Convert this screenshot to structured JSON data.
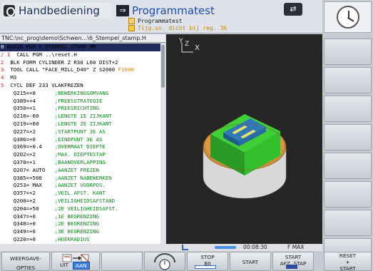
{
  "header": {
    "mode_left": "Handbediening",
    "mode_right": "Programmatest",
    "sub_title": "Programmatest",
    "sub_warning": "Tijg.sn. dicht bij reg. 36"
  },
  "path": "TNC:\\nc_prog\\demo\\Schwen...\\6_Stempel_stamp.H",
  "program": {
    "lines": [
      {
        "n": "0",
        "code": " BEGIN PGM 6_STEMPEL_STAMP MM",
        "cm": ""
      },
      {
        "n": "/ 1",
        "code": "  CALL PGM ..\\reset.H",
        "cm": ""
      },
      {
        "n": "2",
        "code": "  BLK FORM CYLINDER Z R30 L60 DIST+2",
        "cm": ""
      },
      {
        "n": "3",
        "code": "  TOOL CALL \"FACE_MILL_D40\" Z S2000 ",
        "cm": "F1000"
      },
      {
        "n": "4",
        "code": "  M3",
        "cm": ""
      },
      {
        "n": "5",
        "code": "  CYCL DEF 233 VLAKFREZEN",
        "cm": ""
      },
      {
        "n": "",
        "code": "    Q215=+0      ",
        "cm": ";BEWERKINGSOMVANG"
      },
      {
        "n": "",
        "code": "    Q389=+4      ",
        "cm": ";FREESSTRATEGIE"
      },
      {
        "n": "",
        "code": "    Q350=+1      ",
        "cm": ";FREESRICHTING"
      },
      {
        "n": "",
        "code": "    Q218=-60     ",
        "cm": ";LENGTE 1E ZIJKANT"
      },
      {
        "n": "",
        "code": "    Q219=+60     ",
        "cm": ";LENGTE 2E ZIJKANT"
      },
      {
        "n": "",
        "code": "    Q227=+2      ",
        "cm": ";STARTPUNT 3E AS"
      },
      {
        "n": "",
        "code": "    Q386=+0      ",
        "cm": ";EINDPUNT 3E AS"
      },
      {
        "n": "",
        "code": "    Q369=+0.4    ",
        "cm": ";OVERMAAT DIEPTE"
      },
      {
        "n": "",
        "code": "    Q202=+2      ",
        "cm": ";MAX. DIEPTESTAP"
      },
      {
        "n": "",
        "code": "    Q370=+1      ",
        "cm": ";BAANOVERLAPPING"
      },
      {
        "n": "",
        "code": "    Q207= AUTO   ",
        "cm": ";AANZET FREZEN"
      },
      {
        "n": "",
        "code": "    Q385=+500    ",
        "cm": ";AANZET NABEWERKEN"
      },
      {
        "n": "",
        "code": "    Q253= MAX    ",
        "cm": ";AANZET VOORPOS."
      },
      {
        "n": "",
        "code": "    Q357=+2      ",
        "cm": ";VEIL.AFST. KANT"
      },
      {
        "n": "",
        "code": "    Q200=+2      ",
        "cm": ";VEILIGHEIDSAFSTAND"
      },
      {
        "n": "",
        "code": "    Q204=+50     ",
        "cm": ";2E VEILIGHEIDSAFST."
      },
      {
        "n": "",
        "code": "    Q347=+0      ",
        "cm": ";1E BEGRENZING"
      },
      {
        "n": "",
        "code": "    Q348=+0      ",
        "cm": ";2E BEGRENZING"
      },
      {
        "n": "",
        "code": "    Q349=+0      ",
        "cm": ";3E BEGRENZING"
      },
      {
        "n": "",
        "code": "    Q220=+0      ",
        "cm": ";HOEKRADIUS"
      }
    ]
  },
  "view": {
    "axis_label": "X"
  },
  "status": {
    "time": "00:08:30",
    "feed": "F MAX"
  },
  "softkeys": {
    "weergave_1": "WEERGAVE-",
    "weergave_2": "OPTIES",
    "uit": "UIT",
    "aan": "AAN",
    "stop_1": "STOP",
    "stop_2": "BIJ",
    "start": "START",
    "start_afz_1": "START",
    "start_afz_2": "AFZ. STAP",
    "reset_1": "RESET",
    "reset_2": "+",
    "reset_3": "START"
  },
  "colors": {
    "highlight": "#1e2a5c",
    "comment": "#0a8a1a",
    "line_number": "#d41c1c",
    "warning": "#c48a10"
  }
}
